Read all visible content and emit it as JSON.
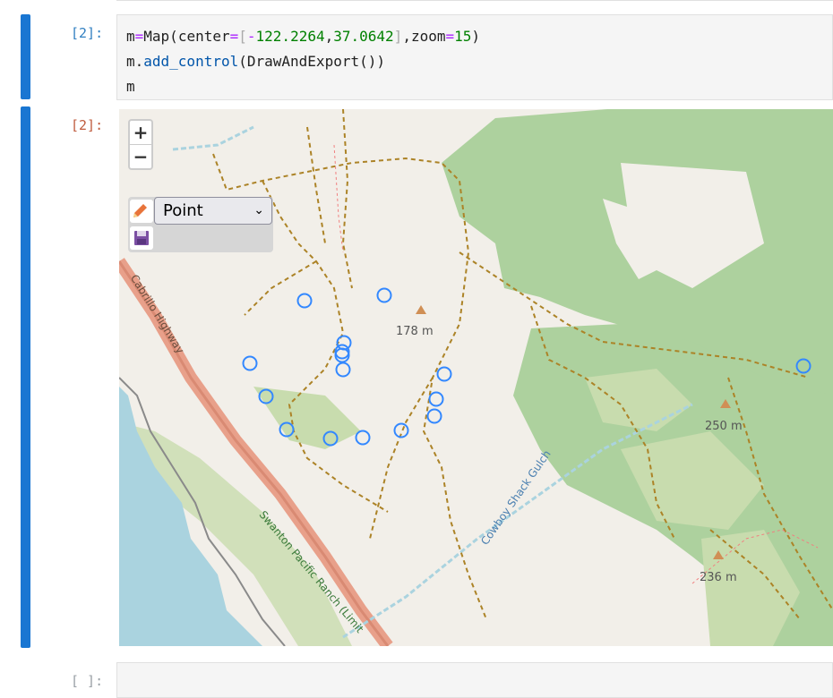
{
  "cells": [
    {
      "prompt": "[2]:",
      "code_lines": [
        [
          {
            "t": "m"
          },
          {
            "t": "=",
            "c": "op"
          },
          {
            "t": "Map(center"
          },
          {
            "t": "=",
            "c": "op"
          },
          {
            "t": "[",
            "c": "br"
          },
          {
            "t": "-",
            "c": "op"
          },
          {
            "t": "122.2264",
            "c": "num"
          },
          {
            "t": ","
          },
          {
            "t": "37.0642",
            "c": "num"
          },
          {
            "t": "]",
            "c": "br"
          },
          {
            "t": ",zoom"
          },
          {
            "t": "=",
            "c": "op"
          },
          {
            "t": "15",
            "c": "num"
          },
          {
            "t": ")"
          }
        ],
        [
          {
            "t": "m."
          },
          {
            "t": "add_control",
            "c": "fn"
          },
          {
            "t": "(DrawAndExport())"
          }
        ],
        [
          {
            "t": "m"
          }
        ]
      ]
    }
  ],
  "output": {
    "prompt": "[2]:",
    "map": {
      "zoom_in": "+",
      "zoom_out": "−",
      "draw_tool": {
        "selected": "Point",
        "options_visible": [
          "Point"
        ],
        "chevron": "⌄"
      },
      "labels": {
        "peak1": "178 m",
        "peak2": "250 m",
        "peak3": "236 m",
        "highway": "Cabrillo Highway",
        "ranch": "Swanton Pacific Ranch (Limit",
        "gulch": "Cowboy Shack Gulch"
      }
    }
  },
  "empty_cell": {
    "prompt": "[ ]:"
  }
}
